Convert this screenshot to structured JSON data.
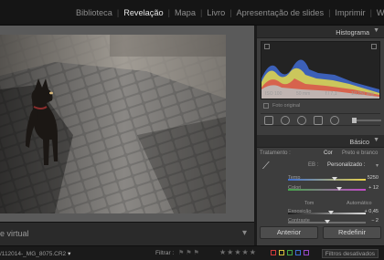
{
  "modules": [
    "Biblioteca",
    "Revelação",
    "Mapa",
    "Livro",
    "Apresentação de slides",
    "Imprimir",
    "We"
  ],
  "active_module": "Revelação",
  "view_label": "e virtual",
  "histogram": {
    "title": "Histograma",
    "readouts": [
      "ISO 100",
      "50 mm",
      "f / 7,1",
      "1/1250 seg"
    ],
    "original_photo_label": "Foto original"
  },
  "basic": {
    "title": "Básico",
    "treatment_label": "Tratamento :",
    "treatment_color": "Cor",
    "treatment_bw": "Preto e branco",
    "wb_label": "EB :",
    "wb_value": "Personalizado :",
    "temp_label": "Temp",
    "temp_value": "5250",
    "tint_label": "Colori",
    "tint_value": "+ 12",
    "tone_label": "Tom",
    "tone_auto": "Automático",
    "exposure_label": "Exposição",
    "exposure_value": "+ 0,45",
    "contrast_label": "Contraste",
    "contrast_value": "− 2"
  },
  "buttons": {
    "previous": "Anterior",
    "reset": "Redefinir"
  },
  "filmstrip": {
    "filename": "/112014-_MG_8075.CR2",
    "filter_label": "Filtrar :",
    "filter_status": "Filtros desativados"
  },
  "colors": {
    "accent": "#e6e6e6",
    "panel": "#3d3d3d",
    "swatches": [
      "#d23b3b",
      "#d6c23a",
      "#41a846",
      "#3c6fd3",
      "#9a48c9"
    ]
  }
}
